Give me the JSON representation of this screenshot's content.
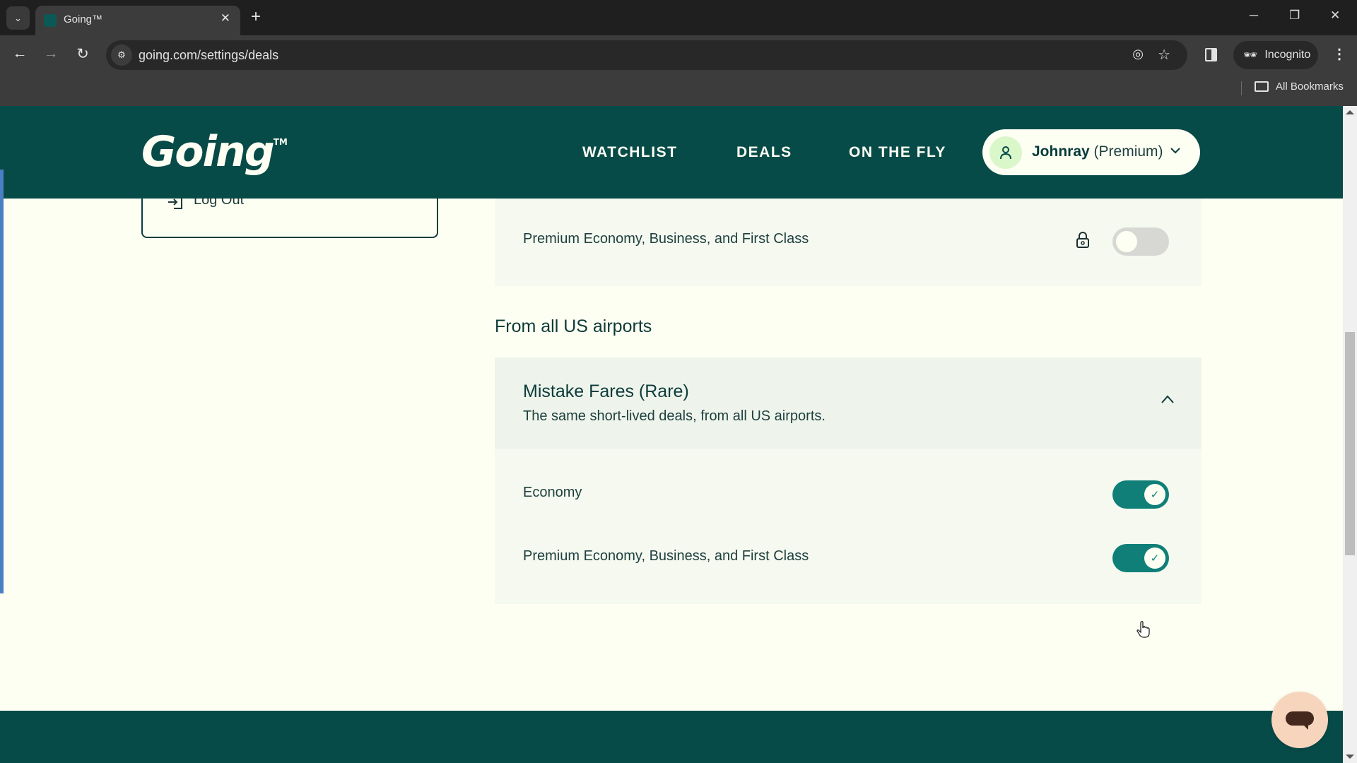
{
  "browser": {
    "tab_title": "Going™",
    "url": "going.com/settings/deals",
    "incognito_label": "Incognito",
    "bookmarks_label": "All Bookmarks",
    "icons": {
      "tab_search": "chevron-down-icon",
      "new_tab": "plus-icon",
      "back": "arrow-left-icon",
      "forward": "arrow-right-icon",
      "reload": "reload-icon",
      "site_info": "tune-icon",
      "tracking": "eye-off-icon",
      "bookmark": "star-icon",
      "menu": "more-vert-icon"
    }
  },
  "header": {
    "logo": "Going",
    "logo_tm": "TM",
    "nav": [
      "WATCHLIST",
      "DEALS",
      "ON THE FLY"
    ],
    "user": {
      "name": "Johnray",
      "tier": "(Premium)"
    }
  },
  "sidebar": {
    "logout_label": "Log Out"
  },
  "settings": {
    "top_card": {
      "items": [
        {
          "label": "Premium Economy, Business, and First Class",
          "enabled": false,
          "locked": true
        }
      ]
    },
    "section_heading": "From all US airports",
    "mistake_fares": {
      "title": "Mistake Fares (Rare)",
      "subtitle": "The same short-lived deals, from all US airports.",
      "expanded": true,
      "items": [
        {
          "label": "Economy",
          "enabled": true
        },
        {
          "label": "Premium Economy, Business, and First Class",
          "enabled": true
        }
      ]
    }
  },
  "colors": {
    "brand_dark": "#074b49",
    "toggle_on": "#0f7f78",
    "toggle_off": "#d7d8d4",
    "page_bg": "#fefff3",
    "card_bg": "#f5f9f0",
    "chat_bg": "#f7d5bd"
  },
  "symbols": {
    "chev_down": "⌄",
    "close": "✕",
    "plus": "+",
    "back": "←",
    "forward": "→",
    "reload": "↻",
    "minimize": "─",
    "restore": "❐",
    "check": "✓",
    "dots": "⋮"
  }
}
